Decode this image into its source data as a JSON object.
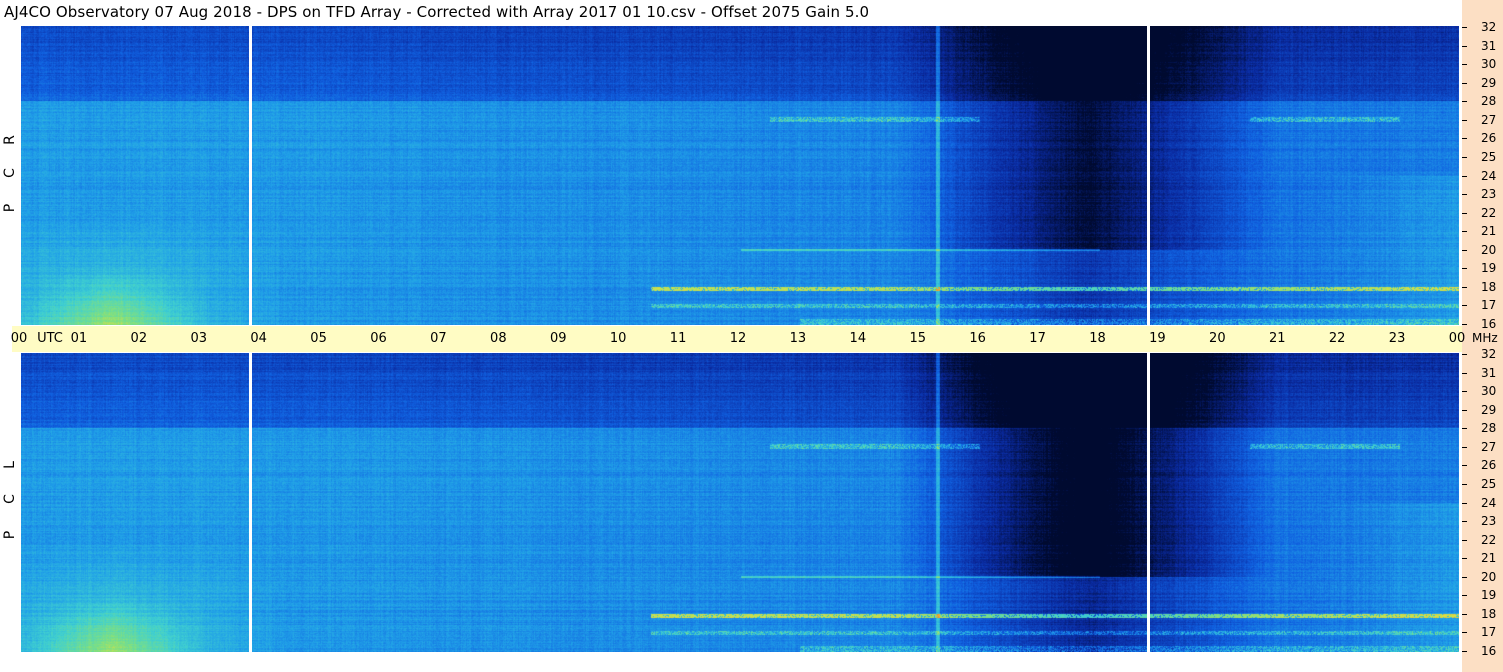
{
  "title": "AJ4CO Observatory  07 Aug 2018  -  DPS on TFD Array  -  Corrected with Array 2017 01 10.csv  -  Offset 2075  Gain 5.0",
  "chart_data": [
    {
      "type": "heatmap",
      "panel": "RCP",
      "side_label": [
        "R",
        "C",
        "P"
      ],
      "x_axis": {
        "unit": "UTC",
        "range_hours": [
          0,
          24
        ],
        "tick_labels": [
          "00",
          "01",
          "02",
          "03",
          "04",
          "05",
          "06",
          "07",
          "08",
          "09",
          "10",
          "11",
          "12",
          "13",
          "14",
          "15",
          "16",
          "17",
          "18",
          "19",
          "20",
          "21",
          "22",
          "23",
          "00"
        ]
      },
      "y_axis": {
        "unit": "MHz",
        "range": [
          16,
          32
        ],
        "tick_labels": [
          32,
          31,
          30,
          29,
          28,
          27,
          26,
          25,
          24,
          23,
          22,
          21,
          20,
          19,
          18,
          17,
          16
        ]
      },
      "colormap": [
        "#000a30",
        "#0a2aa0",
        "#1060e0",
        "#20a0e8",
        "#40d0d0",
        "#80e080",
        "#e0e040",
        "#ff8020"
      ],
      "gaps_utc": [
        3.8,
        18.8
      ],
      "features": {
        "strong_band_MHz": 17.9,
        "secondary_band_MHz": 27.0,
        "low_level_region_utc": [
          15.5,
          20.5
        ]
      }
    },
    {
      "type": "heatmap",
      "panel": "LCP",
      "side_label": [
        "L",
        "C",
        "P"
      ],
      "x_axis": {
        "unit": "UTC",
        "range_hours": [
          0,
          24
        ]
      },
      "y_axis": {
        "unit": "MHz",
        "range": [
          16,
          32
        ],
        "tick_labels": [
          32,
          31,
          30,
          29,
          28,
          27,
          26,
          25,
          24,
          23,
          22,
          21,
          20,
          19,
          18,
          17,
          16
        ]
      },
      "colormap": [
        "#000a30",
        "#0a2aa0",
        "#1060e0",
        "#20a0e8",
        "#40d0d0",
        "#80e080",
        "#e0e040",
        "#ff8020"
      ],
      "gaps_utc": [
        3.8,
        18.8
      ]
    }
  ],
  "axis_text": {
    "utc": "UTC",
    "mhz": "MHz"
  },
  "colors": {
    "utc_bar": "#fffcc4",
    "right_strip": "#fcdfc4"
  }
}
